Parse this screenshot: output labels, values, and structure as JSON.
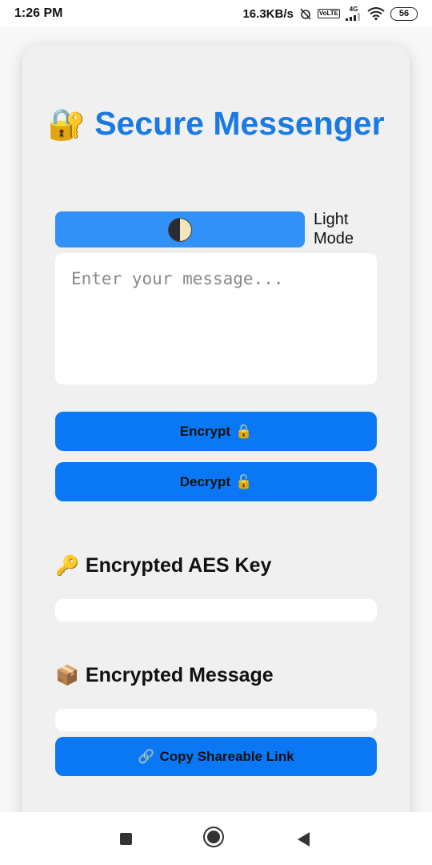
{
  "status_bar": {
    "time": "1:26 PM",
    "speed": "16.3KB/s",
    "volte": "VoLTE",
    "net_top": "4G",
    "net_bottom": "ıl",
    "battery": "56"
  },
  "app": {
    "title_emoji": "🔐",
    "title": "Secure Messenger",
    "theme_toggle": {
      "icon": "half-moon-icon",
      "label": "Light Mode"
    },
    "message_input": {
      "placeholder": "Enter your message...",
      "value": ""
    },
    "encrypt_button": {
      "label": "Encrypt",
      "icon": "🔒"
    },
    "decrypt_button": {
      "label": "Decrypt",
      "icon": "🔓"
    },
    "aes_section": {
      "emoji": "🔑",
      "heading": "Encrypted AES Key",
      "value": ""
    },
    "message_section": {
      "emoji": "📦",
      "heading": "Encrypted Message",
      "value": ""
    },
    "copy_link_button": {
      "icon": "🔗",
      "label": "Copy Shareable Link"
    }
  },
  "colors": {
    "accent": "#0a78f5",
    "title": "#1a7ae3",
    "toggle": "#3191f7",
    "card": "#f0f0f0"
  },
  "nav_bar": {
    "recent_icon": "square-icon",
    "home_icon": "circle-icon",
    "back_icon": "triangle-back-icon"
  }
}
